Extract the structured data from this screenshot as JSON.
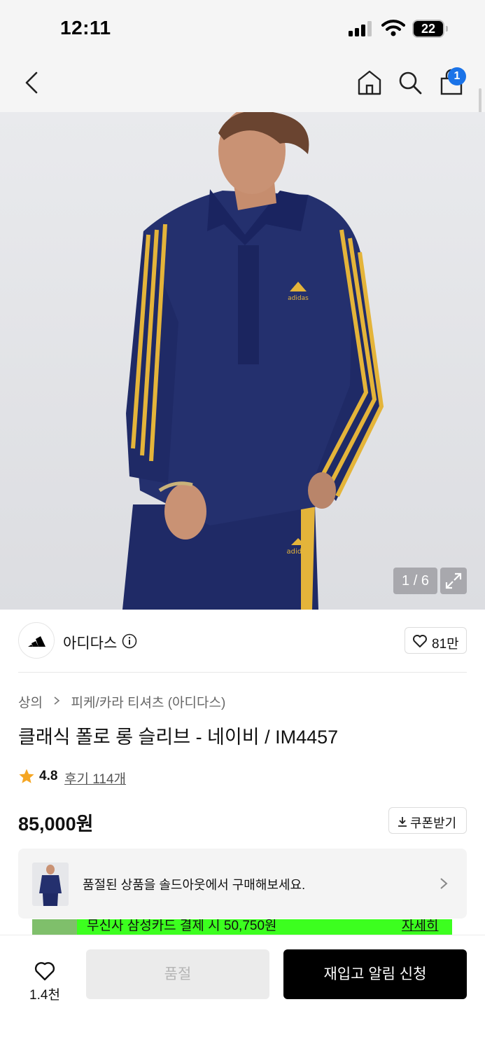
{
  "status_bar": {
    "time": "12:11",
    "battery": "22"
  },
  "nav": {
    "bag_badge": "1"
  },
  "gallery": {
    "counter": "1 / 6",
    "apparel_logo": "adidas"
  },
  "brand": {
    "name": "아디다스",
    "like_count": "81만"
  },
  "breadcrumb": {
    "category": "상의",
    "subcategory": "피케/카라 티셔츠 (아디다스)"
  },
  "product": {
    "title": "클래식 폴로 롱 슬리브 - 네이비 / IM4457",
    "rating": "4.8",
    "reviews": "후기 114개",
    "price": "85,000원"
  },
  "coupon": {
    "label": "쿠폰받기"
  },
  "soldout_banner": {
    "text": "품절된 상품을 솔드아웃에서 구매해보세요."
  },
  "promo": {
    "text": "무신사 삼성카드 결제 시 50,750원",
    "link": "자세히"
  },
  "bottom": {
    "wish_count": "1.4천",
    "soldout_label": "품절",
    "restock_label": "재입고 알림 신청"
  },
  "colors": {
    "accent_blue": "#1a73e8",
    "star": "#f5a623",
    "promo_green": "#3cff1f",
    "garment_navy": "#1f2a66",
    "stripe_yellow": "#e4b43a"
  },
  "icons": [
    "back-icon",
    "home-icon",
    "search-icon",
    "bag-icon",
    "expand-icon",
    "info-icon",
    "heart-icon",
    "star-icon",
    "download-icon",
    "chevron-right-icon"
  ]
}
